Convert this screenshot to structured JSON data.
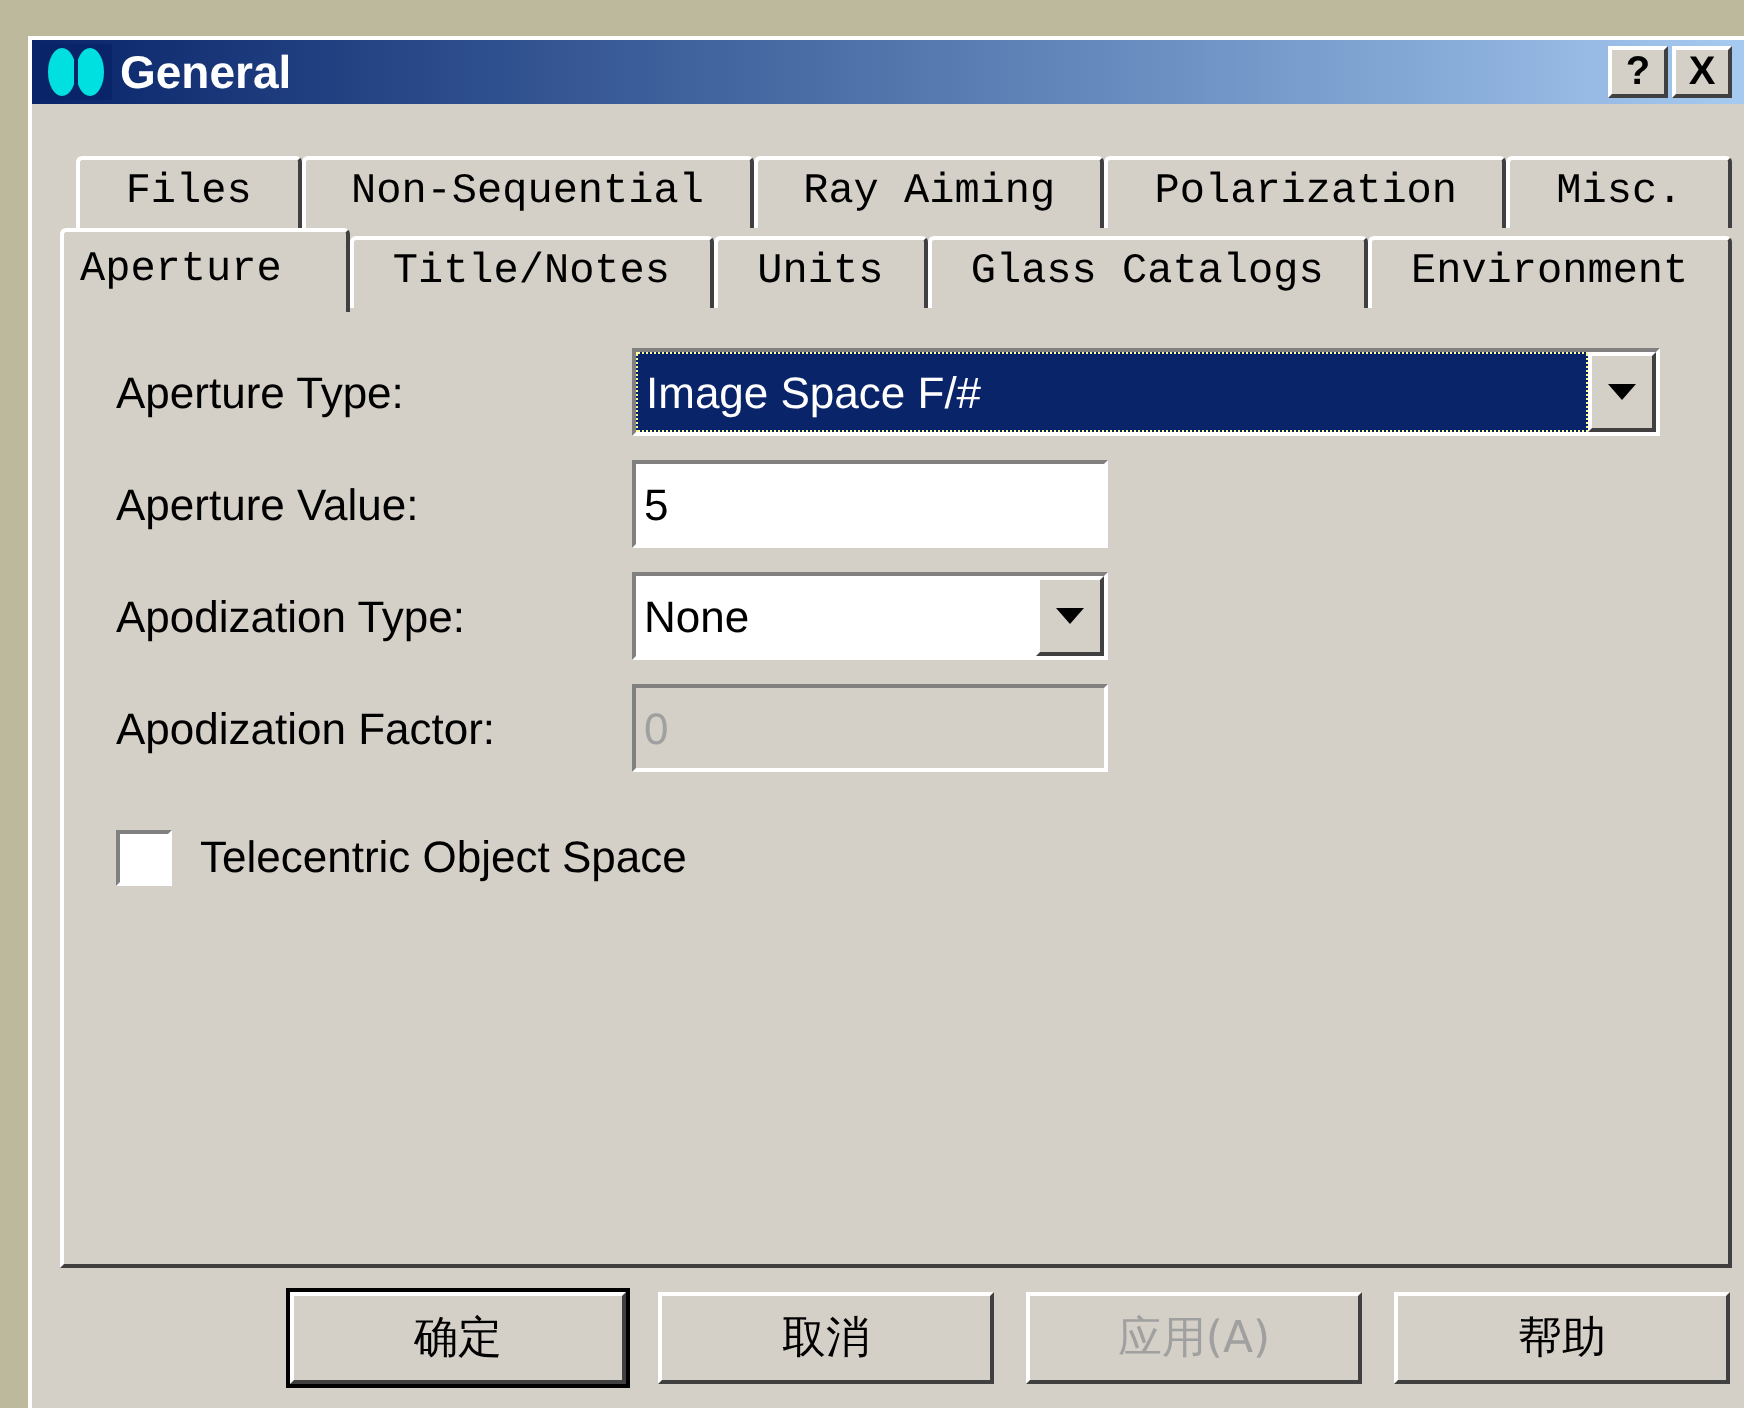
{
  "window": {
    "title": "General",
    "title_buttons": [
      "?",
      "X"
    ]
  },
  "tab_rows": [
    [
      {
        "label": "Files",
        "selected": false
      },
      {
        "label": "Non-Sequential",
        "selected": false
      },
      {
        "label": "Ray Aiming",
        "selected": false
      },
      {
        "label": "Polarization",
        "selected": false
      },
      {
        "label": "Misc.",
        "selected": false
      }
    ],
    [
      {
        "label": "Aperture",
        "selected": true
      },
      {
        "label": "Title/Notes",
        "selected": false
      },
      {
        "label": "Units",
        "selected": false
      },
      {
        "label": "Glass Catalogs",
        "selected": false
      },
      {
        "label": "Environment",
        "selected": false
      }
    ]
  ],
  "fields": [
    {
      "label": "Aperture Type:",
      "kind": "dropdown",
      "value": "Image Space F/#",
      "focused": true,
      "disabled": false
    },
    {
      "label": "Aperture Value:",
      "kind": "text",
      "value": "5",
      "focused": false,
      "disabled": false
    },
    {
      "label": "Apodization Type:",
      "kind": "dropdown",
      "value": "None",
      "focused": false,
      "disabled": false
    },
    {
      "label": "Apodization Factor:",
      "kind": "text",
      "value": "0",
      "focused": false,
      "disabled": true
    }
  ],
  "checkbox": {
    "label": "Telecentric Object Space",
    "checked": false
  },
  "buttons": [
    {
      "label": "确定",
      "default": true,
      "disabled": false
    },
    {
      "label": "取消",
      "default": false,
      "disabled": false
    },
    {
      "label": "应用(A)",
      "default": false,
      "disabled": true
    },
    {
      "label": "帮助",
      "default": false,
      "disabled": false
    }
  ]
}
